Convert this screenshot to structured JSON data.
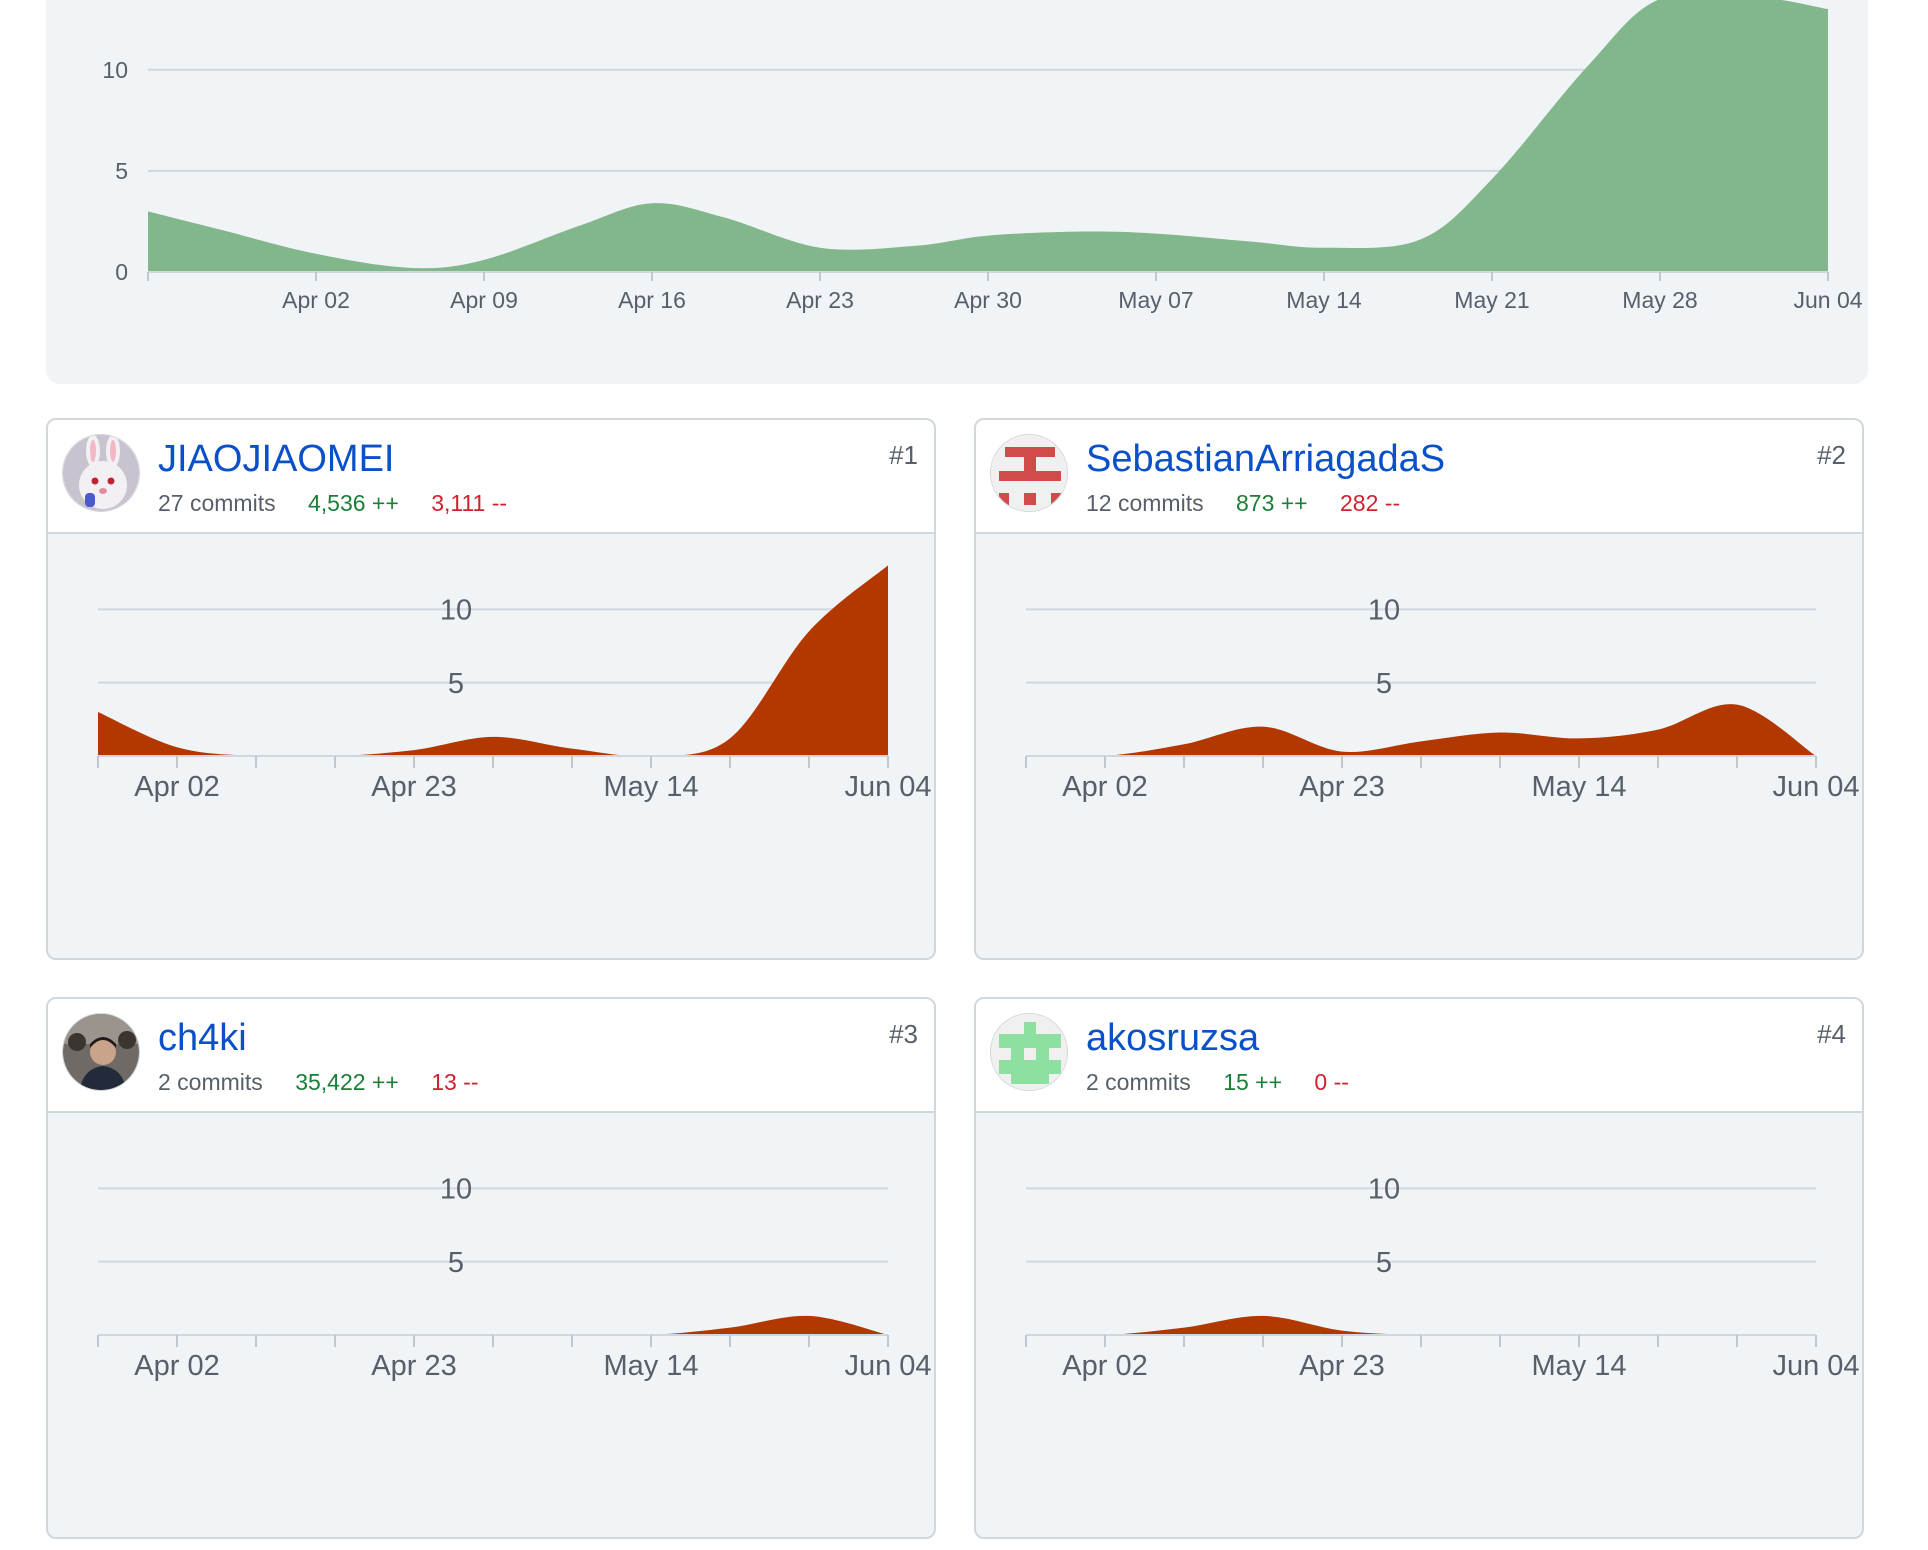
{
  "colors": {
    "overview_fill": "#82b68b",
    "contributor_fill": "#b23800",
    "grid": "#d0d7de",
    "link": "#0a50c8",
    "additions": "#1a7f37",
    "deletions": "#cf222e"
  },
  "overview": {
    "chart_data": {
      "type": "area",
      "xlabel": "",
      "ylabel": "",
      "ylim": [
        0,
        13.5
      ],
      "y_ticks": [
        "0",
        "5",
        "10"
      ],
      "x_ticks": [
        "Apr 02",
        "Apr 09",
        "Apr 16",
        "Apr 23",
        "Apr 30",
        "May 07",
        "May 14",
        "May 21",
        "May 28",
        "Jun 04"
      ],
      "x_start": "2024-03-26",
      "x_end": "2024-06-04",
      "grid": true,
      "series": [
        {
          "points": [
            [
              "2024-03-26",
              3.0
            ],
            [
              "2024-03-29",
              2.1
            ],
            [
              "2024-04-02",
              0.9
            ],
            [
              "2024-04-06",
              0.2
            ],
            [
              "2024-04-09",
              0.6
            ],
            [
              "2024-04-13",
              2.3
            ],
            [
              "2024-04-16",
              3.4
            ],
            [
              "2024-04-19",
              2.7
            ],
            [
              "2024-04-23",
              1.2
            ],
            [
              "2024-04-27",
              1.3
            ],
            [
              "2024-04-30",
              1.8
            ],
            [
              "2024-05-04",
              2.0
            ],
            [
              "2024-05-07",
              1.9
            ],
            [
              "2024-05-11",
              1.5
            ],
            [
              "2024-05-14",
              1.2
            ],
            [
              "2024-05-18",
              1.6
            ],
            [
              "2024-05-21",
              4.6
            ],
            [
              "2024-05-25",
              10.2
            ],
            [
              "2024-05-28",
              13.5
            ],
            [
              "2024-06-01",
              13.6
            ],
            [
              "2024-06-04",
              13.0
            ]
          ]
        }
      ]
    }
  },
  "contributors": [
    {
      "rank": "#1",
      "username": "JIAOJIAOMEI",
      "commits": "27 commits",
      "additions": "4,536 ++",
      "deletions": "3,111 --",
      "avatar_icon": "rabbit-avatar-icon",
      "chart_data": {
        "type": "area",
        "xlabel": "",
        "ylabel": "",
        "ylim": [
          0,
          13.5
        ],
        "y_ticks": [
          "5",
          "10"
        ],
        "x_ticks": [
          "Apr 02",
          "Apr 23",
          "May 14",
          "Jun 04"
        ],
        "x_start": "2024-03-26",
        "x_end": "2024-06-04",
        "grid": true,
        "series": [
          {
            "points": [
              [
                "2024-03-26",
                3.0
              ],
              [
                "2024-04-02",
                0.6
              ],
              [
                "2024-04-09",
                0.0
              ],
              [
                "2024-04-16",
                0.0
              ],
              [
                "2024-04-23",
                0.4
              ],
              [
                "2024-04-30",
                1.3
              ],
              [
                "2024-05-07",
                0.5
              ],
              [
                "2024-05-14",
                0.0
              ],
              [
                "2024-05-21",
                1.2
              ],
              [
                "2024-05-28",
                8.5
              ],
              [
                "2024-06-04",
                13.0
              ]
            ]
          }
        ]
      }
    },
    {
      "rank": "#2",
      "username": "SebastianArriagadaS",
      "commits": "12 commits",
      "additions": "873 ++",
      "deletions": "282 --",
      "avatar_icon": "red-identicon-avatar-icon",
      "chart_data": {
        "type": "area",
        "xlabel": "",
        "ylabel": "",
        "ylim": [
          0,
          13.5
        ],
        "y_ticks": [
          "5",
          "10"
        ],
        "x_ticks": [
          "Apr 02",
          "Apr 23",
          "May 14",
          "Jun 04"
        ],
        "x_start": "2024-03-26",
        "x_end": "2024-06-04",
        "grid": true,
        "series": [
          {
            "points": [
              [
                "2024-03-26",
                0.0
              ],
              [
                "2024-04-02",
                0.0
              ],
              [
                "2024-04-09",
                0.8
              ],
              [
                "2024-04-16",
                2.0
              ],
              [
                "2024-04-23",
                0.3
              ],
              [
                "2024-04-30",
                1.0
              ],
              [
                "2024-05-07",
                1.6
              ],
              [
                "2024-05-14",
                1.2
              ],
              [
                "2024-05-21",
                1.8
              ],
              [
                "2024-05-28",
                3.5
              ],
              [
                "2024-06-04",
                0.0
              ]
            ]
          }
        ]
      }
    },
    {
      "rank": "#3",
      "username": "ch4ki",
      "commits": "2 commits",
      "additions": "35,422 ++",
      "deletions": "13 --",
      "avatar_icon": "photo-avatar-icon",
      "chart_data": {
        "type": "area",
        "xlabel": "",
        "ylabel": "",
        "ylim": [
          0,
          13.5
        ],
        "y_ticks": [
          "5",
          "10"
        ],
        "x_ticks": [
          "Apr 02",
          "Apr 23",
          "May 14",
          "Jun 04"
        ],
        "x_start": "2024-03-26",
        "x_end": "2024-06-04",
        "grid": true,
        "series": [
          {
            "points": [
              [
                "2024-03-26",
                0.0
              ],
              [
                "2024-04-02",
                0.0
              ],
              [
                "2024-04-09",
                0.0
              ],
              [
                "2024-04-16",
                0.0
              ],
              [
                "2024-04-23",
                0.0
              ],
              [
                "2024-04-30",
                0.0
              ],
              [
                "2024-05-07",
                0.0
              ],
              [
                "2024-05-14",
                0.0
              ],
              [
                "2024-05-21",
                0.5
              ],
              [
                "2024-05-28",
                1.3
              ],
              [
                "2024-06-04",
                0.0
              ]
            ]
          }
        ]
      }
    },
    {
      "rank": "#4",
      "username": "akosruzsa",
      "commits": "2 commits",
      "additions": "15 ++",
      "deletions": "0 --",
      "avatar_icon": "green-identicon-avatar-icon",
      "chart_data": {
        "type": "area",
        "xlabel": "",
        "ylabel": "",
        "ylim": [
          0,
          13.5
        ],
        "y_ticks": [
          "5",
          "10"
        ],
        "x_ticks": [
          "Apr 02",
          "Apr 23",
          "May 14",
          "Jun 04"
        ],
        "x_start": "2024-03-26",
        "x_end": "2024-06-04",
        "grid": true,
        "series": [
          {
            "points": [
              [
                "2024-03-26",
                0.0
              ],
              [
                "2024-04-02",
                0.0
              ],
              [
                "2024-04-09",
                0.5
              ],
              [
                "2024-04-16",
                1.3
              ],
              [
                "2024-04-23",
                0.3
              ],
              [
                "2024-04-30",
                0.0
              ],
              [
                "2024-05-07",
                0.0
              ],
              [
                "2024-05-14",
                0.0
              ],
              [
                "2024-05-21",
                0.0
              ],
              [
                "2024-05-28",
                0.0
              ],
              [
                "2024-06-04",
                0.0
              ]
            ]
          }
        ]
      }
    }
  ]
}
